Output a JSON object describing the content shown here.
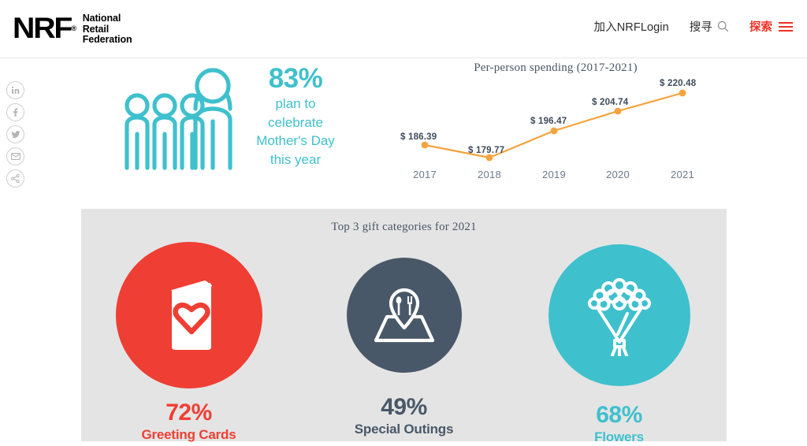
{
  "header": {
    "logo": {
      "mark": "NRF",
      "registered": "®",
      "line1": "National",
      "line2": "Retail",
      "line3": "Federation"
    },
    "nav": {
      "join_login": "加入NRFLogin",
      "search_label": "搜寻",
      "search_icon": "search-icon",
      "explore_label": "探索",
      "menu_icon": "hamburger-icon",
      "accent_color": "#ee3124"
    }
  },
  "social_rail": {
    "items": [
      {
        "name": "linkedin-icon",
        "glyph": "in"
      },
      {
        "name": "facebook-icon",
        "glyph": "f"
      },
      {
        "name": "twitter-icon",
        "glyph": "t"
      },
      {
        "name": "email-icon",
        "glyph": "envelope"
      },
      {
        "name": "share-icon",
        "glyph": "share"
      }
    ]
  },
  "hero": {
    "people_icon": "group-of-people-icon",
    "stat": {
      "value": "83%",
      "line1": "plan to",
      "line2": "celebrate",
      "line3": "Mother's Day",
      "line4": "this year"
    },
    "teal": "#3fc0cd"
  },
  "chart_data": {
    "type": "line",
    "title": "Per-person spending (2017-2021)",
    "xlabel": "",
    "ylabel": "",
    "categories": [
      "2017",
      "2018",
      "2019",
      "2020",
      "2021"
    ],
    "values": [
      186.39,
      179.77,
      196.47,
      204.74,
      220.48
    ],
    "point_labels": [
      "$  186.39",
      "$ 179.77",
      "$  196.47",
      "$   204.74",
      "$ 220.48"
    ],
    "series": [
      {
        "name": "Per-person spending",
        "values": [
          186.39,
          179.77,
          196.47,
          204.74,
          220.48
        ]
      }
    ],
    "ylim": [
      170,
      228
    ],
    "grid": false,
    "legend": "none",
    "line_color": "#f5a33c",
    "marker_color": "#f5a33c"
  },
  "panel": {
    "title": "Top 3 gift categories for 2021",
    "background": "#e4e4e4",
    "categories": [
      {
        "percent": "72%",
        "label": "Greeting Cards",
        "color": "#ef3e33",
        "icon": "greeting-card-heart-icon"
      },
      {
        "percent": "49%",
        "label": "Special Outings",
        "color": "#495868",
        "icon": "map-pin-cutlery-icon"
      },
      {
        "percent": "68%",
        "label": "Flowers",
        "color": "#3fc0cd",
        "icon": "flower-bouquet-icon"
      }
    ]
  }
}
